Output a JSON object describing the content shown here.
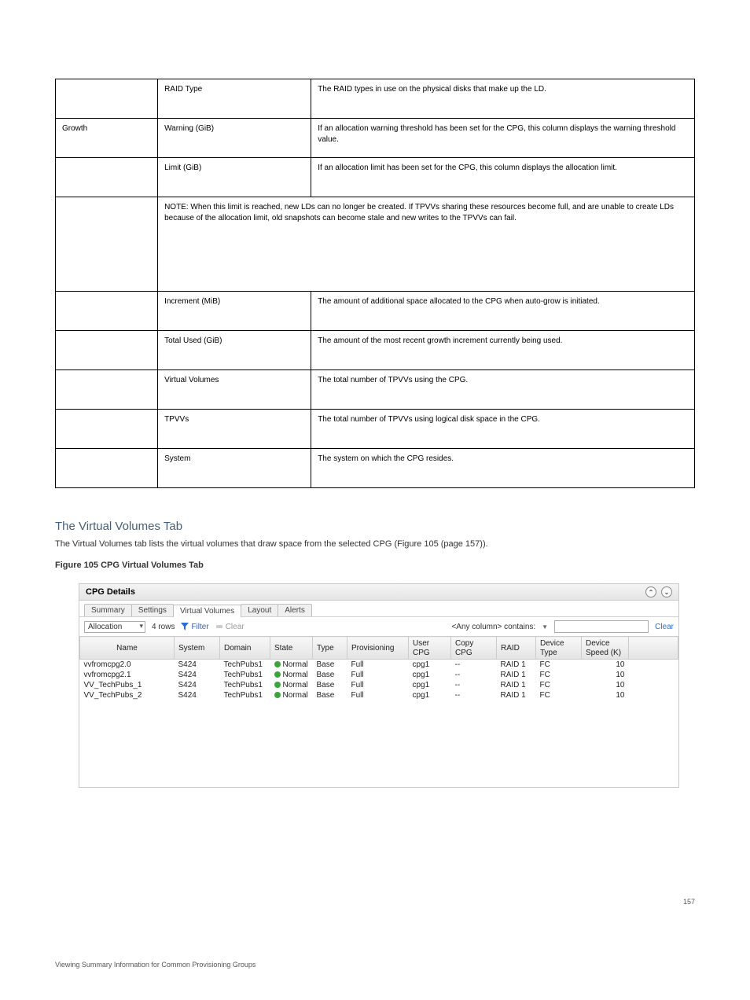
{
  "doc": {
    "footer_left": "Viewing Summary Information for Common Provisioning Groups",
    "page_number": "157"
  },
  "param_table": {
    "rows": [
      {
        "c0": "",
        "c1": "RAID Type",
        "c2": "The RAID types in use on the physical disks that make up the LD.",
        "indent": false
      },
      {
        "c0": "Growth",
        "c1": "Warning (GiB)",
        "c2": "If an allocation warning threshold has been set for the CPG, this column displays the warning threshold value.",
        "indent": false
      },
      {
        "c0": "",
        "c1": "Limit (GiB)",
        "c2": "If an allocation limit has been set for the CPG, this column displays the allocation limit.",
        "indent": true
      },
      {
        "c0": "",
        "c1_span3": true,
        "c1": "NOTE: When this limit is reached, new LDs can no longer be created. If TPVVs sharing these resources become full, and are unable to create LDs because of the allocation limit, old snapshots can become stale and new writes to the TPVVs can fail.",
        "indent": true
      },
      {
        "c0": "",
        "c1": "Increment (MiB)",
        "c2": "The amount of additional space allocated to the CPG when auto-grow is initiated.",
        "indent": true
      },
      {
        "c0": "",
        "c1": "Total Used (GiB)",
        "c2": "The amount of the most recent growth increment currently being used.",
        "indent": true
      },
      {
        "c0": "",
        "c1": "Virtual Volumes",
        "c2": "The total number of TPVVs using the CPG.",
        "indent": true
      },
      {
        "c0": "",
        "c1": "TPVVs",
        "c2": "The total number of TPVVs using logical disk space in the CPG.",
        "indent": true
      },
      {
        "c0": "",
        "c1": "System",
        "c2": "The system on which the CPG resides.",
        "indent": true
      }
    ]
  },
  "heading": "The Virtual Volumes Tab",
  "para": "The Virtual Volumes tab lists the virtual volumes that draw space from the selected CPG (Figure 105 (page 157)).",
  "panel": {
    "title": "CPG Details",
    "tabs": [
      "Summary",
      "Settings",
      "Virtual Volumes",
      "Layout",
      "Alerts"
    ],
    "active_tab": 2,
    "dropdown": "Allocation",
    "rows_label": "4 rows",
    "filter_label": "Filter",
    "toolbar_clear_label": "Clear",
    "search_prefix": "<Any column> contains:",
    "search_value": "",
    "clear_link": "Clear",
    "columns": [
      "Name",
      "System",
      "Domain",
      "State",
      "Type",
      "Provisioning",
      "User CPG",
      "Copy CPG",
      "RAID",
      "Device Type",
      "Device Speed (K)"
    ],
    "data_rows": [
      {
        "name": "vvfromcpg2.0",
        "system": "S424",
        "domain": "TechPubs1",
        "state": "Normal",
        "type": "Base",
        "prov": "Full",
        "usercpg": "cpg1",
        "copycpg": "--",
        "raid": "RAID 1",
        "devtype": "FC",
        "devspeed": "10"
      },
      {
        "name": "vvfromcpg2.1",
        "system": "S424",
        "domain": "TechPubs1",
        "state": "Normal",
        "type": "Base",
        "prov": "Full",
        "usercpg": "cpg1",
        "copycpg": "--",
        "raid": "RAID 1",
        "devtype": "FC",
        "devspeed": "10"
      },
      {
        "name": "VV_TechPubs_1",
        "system": "S424",
        "domain": "TechPubs1",
        "state": "Normal",
        "type": "Base",
        "prov": "Full",
        "usercpg": "cpg1",
        "copycpg": "--",
        "raid": "RAID 1",
        "devtype": "FC",
        "devspeed": "10"
      },
      {
        "name": "VV_TechPubs_2",
        "system": "S424",
        "domain": "TechPubs1",
        "state": "Normal",
        "type": "Base",
        "prov": "Full",
        "usercpg": "cpg1",
        "copycpg": "--",
        "raid": "RAID 1",
        "devtype": "FC",
        "devspeed": "10"
      }
    ]
  },
  "figure_caption": "Figure 105 CPG Virtual Volumes Tab"
}
